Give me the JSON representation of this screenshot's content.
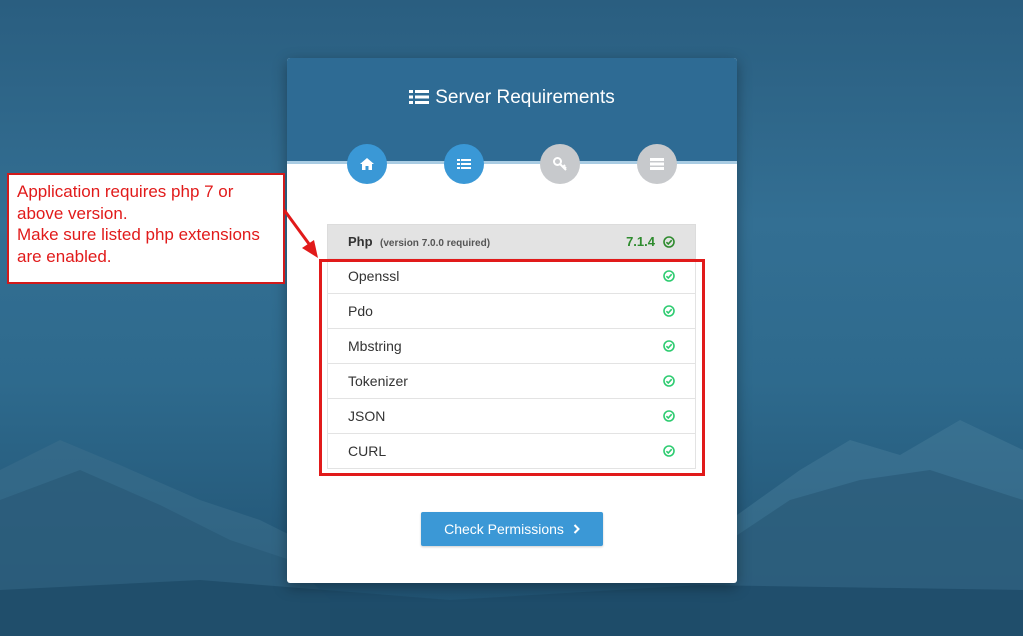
{
  "header": {
    "title": "Server Requirements",
    "title_icon": "list-icon"
  },
  "steps": [
    {
      "icon": "home-icon",
      "state": "active"
    },
    {
      "icon": "list-icon",
      "state": "active"
    },
    {
      "icon": "key-icon",
      "state": "inactive"
    },
    {
      "icon": "server-icon",
      "state": "inactive"
    }
  ],
  "requirements": {
    "php_label": "Php",
    "php_note": "(version 7.0.0 required)",
    "php_version": "7.1.4",
    "extensions": [
      "Openssl",
      "Pdo",
      "Mbstring",
      "Tokenizer",
      "JSON",
      "CURL"
    ]
  },
  "button": {
    "label": "Check Permissions"
  },
  "annotation": {
    "lines": [
      "Application requires php 7 or",
      "above version.",
      "Make sure listed php extensions",
      "are enabled."
    ]
  },
  "colors": {
    "header": "#2e6b94",
    "accent": "#3b98d6",
    "ok": "#2ecc71",
    "annotation": "#e11a1a"
  }
}
